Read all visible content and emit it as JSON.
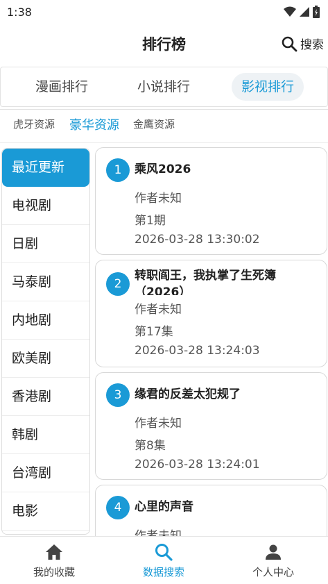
{
  "status": {
    "time": "1:38"
  },
  "header": {
    "title": "排行榜",
    "search_label": "搜索"
  },
  "tabs": [
    {
      "label": "漫画排行",
      "active": false
    },
    {
      "label": "小说排行",
      "active": false
    },
    {
      "label": "影视排行",
      "active": true
    }
  ],
  "sources": [
    {
      "label": "虎牙资源",
      "active": false
    },
    {
      "label": "豪华资源",
      "active": true
    },
    {
      "label": "金鹰资源",
      "active": false
    }
  ],
  "categories": [
    "最近更新",
    "电视剧",
    "日剧",
    "马泰剧",
    "内地剧",
    "欧美剧",
    "香港剧",
    "韩剧",
    "台湾剧",
    "电影"
  ],
  "items": [
    {
      "rank": "1",
      "title": "乘风2026",
      "author": "作者未知",
      "episode": "第1期",
      "time": "2026-03-28 13:30:02"
    },
    {
      "rank": "2",
      "title": "转职阎王，我执掌了生死簿（2026）",
      "author": "作者未知",
      "episode": "第17集",
      "time": "2026-03-28 13:24:03"
    },
    {
      "rank": "3",
      "title": "缘君的反差太犯规了",
      "author": "作者未知",
      "episode": "第8集",
      "time": "2026-03-28 13:24:01"
    },
    {
      "rank": "4",
      "title": "心里的声音",
      "author": "作者未知"
    }
  ],
  "bottom_nav": [
    {
      "label": "我的收藏",
      "icon": "home-icon"
    },
    {
      "label": "数据搜索",
      "icon": "search-icon",
      "active": true
    },
    {
      "label": "个人中心",
      "icon": "person-icon"
    }
  ],
  "colors": {
    "accent": "#1a9ad6",
    "text": "#222222",
    "muted": "#555555"
  }
}
